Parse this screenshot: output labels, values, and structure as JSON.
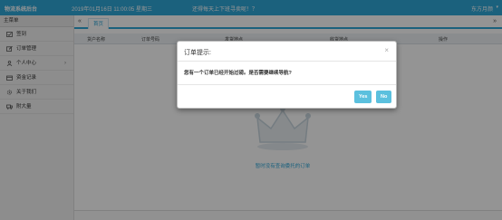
{
  "topbar": {
    "app_title": "物流系统后台",
    "datetime": "2019年01月16日 11:00:05 星期三",
    "notice": "还得每天上下班寻卖呢！？",
    "user": "东方月颜",
    "user_caret": "▾"
  },
  "sidebar": {
    "title": "主菜单",
    "items": [
      {
        "label": "签到",
        "icon": "checkin-icon"
      },
      {
        "label": "订单管理",
        "icon": "edit-icon"
      },
      {
        "label": "个人中心",
        "icon": "user-icon",
        "has_arrow": true
      },
      {
        "label": "资金记录",
        "icon": "wallet-icon"
      },
      {
        "label": "关于我们",
        "icon": "gear-icon"
      },
      {
        "label": "附大量",
        "icon": "truck-icon"
      }
    ],
    "arrow": "›"
  },
  "tabbar": {
    "nav_left": "«",
    "home_tab": "首页",
    "nav_right": "»"
  },
  "table": {
    "columns": [
      "货户名称",
      "订单号码",
      "发货地点",
      "收货地点",
      "操作"
    ]
  },
  "empty_state": {
    "text": "暂时没有查询委托的订单"
  },
  "dialog": {
    "title": "订单提示:",
    "close": "×",
    "message": "您有一个订单已经开始过磅。是否需要继续导航?",
    "yes_label": "Yes",
    "no_label": "No"
  },
  "colors": {
    "primary": "#2fa7d8",
    "button": "#5bc0de"
  }
}
